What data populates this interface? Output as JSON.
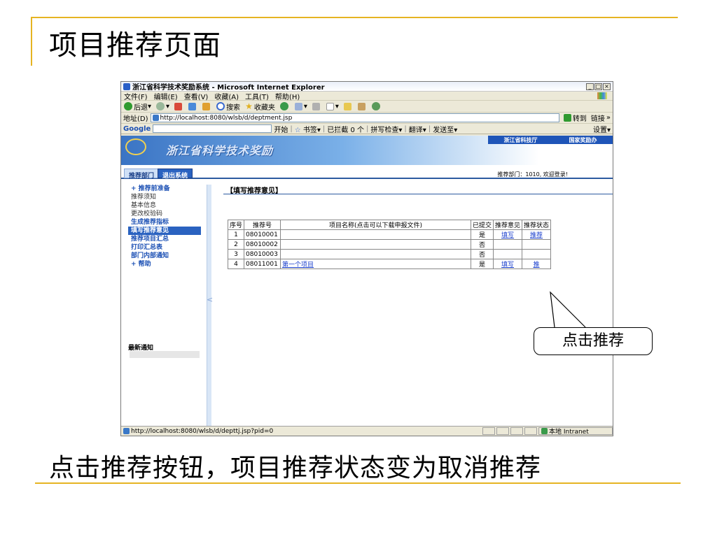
{
  "slide": {
    "title": "项目推荐页面",
    "caption": "点击推荐按钮，项目推荐状态变为取消推荐",
    "callout": "点击推荐",
    "accent_color": "#e6b422"
  },
  "browser": {
    "window_title": "浙江省科学技术奖励系统 - Microsoft Internet Explorer",
    "menu": [
      "文件(F)",
      "编辑(E)",
      "查看(V)",
      "收藏(A)",
      "工具(T)",
      "帮助(H)"
    ],
    "toolbar": {
      "back": "后退",
      "search": "搜索",
      "favorites": "收藏夹"
    },
    "address_label": "地址(D)",
    "address_value": "http://localhost:8080/wlsb/d/deptment.jsp",
    "go_label": "转到",
    "links_label": "链接",
    "google_bar": {
      "logo": "Google",
      "start": "开始",
      "bookmarks": "书签",
      "blocked": "已拦截 0 个",
      "spellcheck": "拼写检查",
      "translate": "翻译",
      "send_to": "发送至",
      "settings": "设置"
    },
    "status_url": "http://localhost:8080/wlsb/d/depttj.jsp?pid=0",
    "status_zone": "本地 Intranet"
  },
  "site": {
    "banner_title": "浙江省科学技术奖励",
    "banner_links": [
      "浙江省科技厅",
      "国家奖励办"
    ],
    "nav_tabs": [
      "推荐部门",
      "退出系统"
    ],
    "welcome": "推荐部门：1010, 欢迎登录!",
    "sidebar": [
      {
        "label": "+ 推荐前准备",
        "style": "blue"
      },
      {
        "label": "推荐须知",
        "style": "plain"
      },
      {
        "label": "基本信息",
        "style": "plain"
      },
      {
        "label": "更改校验码",
        "style": "plain"
      },
      {
        "label": "生成推荐指标",
        "style": "blue"
      },
      {
        "label": "填写推荐意见",
        "style": "active"
      },
      {
        "label": "推荐项目汇总",
        "style": "blue"
      },
      {
        "label": "打印汇总表",
        "style": "blue"
      },
      {
        "label": "部门内部通知",
        "style": "blue"
      },
      {
        "label": "+ 帮助",
        "style": "blue"
      }
    ],
    "latest_notice": "最新通知",
    "section_title": "【填写推荐意见】",
    "table": {
      "headers": [
        "序号",
        "推荐号",
        "项目名称(点击可以下载申报文件)",
        "已提交",
        "推荐意见",
        "推荐状态"
      ],
      "rows": [
        {
          "no": "1",
          "code": "08010001",
          "name": "",
          "submitted": "是",
          "opinion": "填写",
          "status": "推荐"
        },
        {
          "no": "2",
          "code": "08010002",
          "name": "",
          "submitted": "否",
          "opinion": "",
          "status": ""
        },
        {
          "no": "3",
          "code": "08010003",
          "name": "",
          "submitted": "否",
          "opinion": "",
          "status": ""
        },
        {
          "no": "4",
          "code": "08011001",
          "name": "第一个项目",
          "submitted": "是",
          "opinion": "填写",
          "status": "推"
        }
      ]
    }
  }
}
